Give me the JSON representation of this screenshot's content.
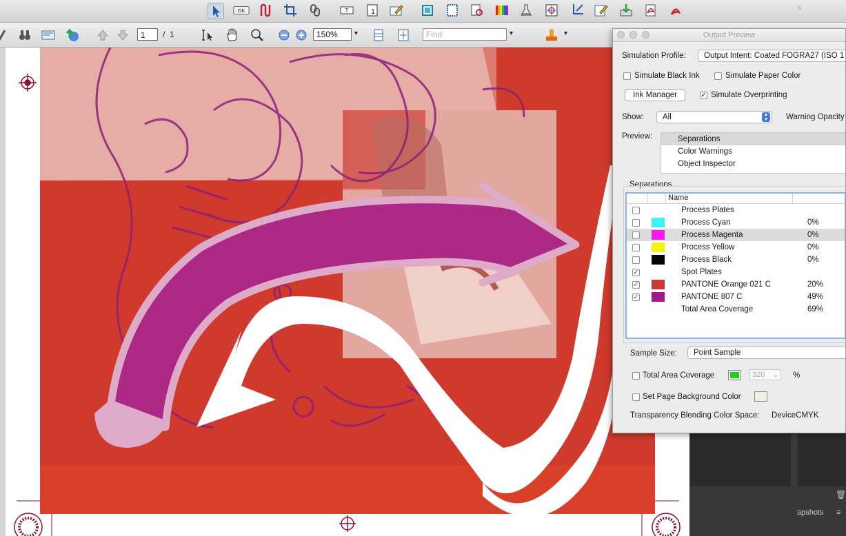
{
  "toolbar_nav": {
    "page_current": "1",
    "page_separator": "/",
    "page_total": "1",
    "zoom": "150%",
    "find_placeholder": "Find"
  },
  "toolbar_icons": [
    "select-arrow-icon",
    "ok-button-icon",
    "path-tool-icon",
    "crop-icon",
    "link-icon",
    "text-field-icon",
    "page-number-icon",
    "edit-icon",
    "trim-box-icon",
    "page-box-icon",
    "preflight-icon",
    "color-bars-icon",
    "flask-icon",
    "registration-target-icon",
    "object-crop-icon",
    "pencil-icon",
    "export-icon",
    "pdf-icon",
    "acrobat-icon"
  ],
  "output_preview": {
    "title": "Output Preview",
    "simulation_profile_label": "Simulation Profile:",
    "simulation_profile_value": "Output Intent: Coated FOGRA27 (ISO 1",
    "simulate_black_ink": "Simulate Black Ink",
    "simulate_black_ink_checked": false,
    "simulate_paper_color": "Simulate Paper Color",
    "simulate_paper_color_checked": false,
    "ink_manager": "Ink Manager",
    "simulate_overprinting": "Simulate Overprinting",
    "simulate_overprinting_checked": true,
    "show_label": "Show:",
    "show_value": "All",
    "warning_opacity": "Warning Opacity",
    "preview_label": "Preview:",
    "preview_options": [
      "Separations",
      "Color Warnings",
      "Object Inspector"
    ],
    "preview_selected": "Separations",
    "separations_group": "Separations",
    "separations_header_name": "Name",
    "separations": [
      {
        "name": "Process Plates",
        "pct": "",
        "color": "",
        "checked": false,
        "highlight": false
      },
      {
        "name": "Process Cyan",
        "pct": "0%",
        "color": "#3ef3f7",
        "checked": false,
        "highlight": false
      },
      {
        "name": "Process Magenta",
        "pct": "0%",
        "color": "#f21cee",
        "checked": false,
        "highlight": true
      },
      {
        "name": "Process Yellow",
        "pct": "0%",
        "color": "#f7f212",
        "checked": false,
        "highlight": false
      },
      {
        "name": "Process Black",
        "pct": "0%",
        "color": "#050505",
        "checked": false,
        "highlight": false
      },
      {
        "name": "Spot Plates",
        "pct": "",
        "color": "",
        "checked": true,
        "highlight": false
      },
      {
        "name": "PANTONE Orange 021 C",
        "pct": "20%",
        "color": "#c93a30",
        "checked": true,
        "highlight": false
      },
      {
        "name": "PANTONE 807 C",
        "pct": "49%",
        "color": "#a1198a",
        "checked": true,
        "highlight": false
      },
      {
        "name": "Total Area Coverage",
        "pct": "69%",
        "color": "",
        "checked": null,
        "highlight": false
      }
    ],
    "sample_size_label": "Sample Size:",
    "sample_size_value": "Point Sample",
    "total_area_coverage": "Total Area Coverage",
    "total_area_coverage_checked": false,
    "coverage_limit": "320",
    "percent_sign": "%",
    "coverage_color": "#22cc22",
    "set_page_background": "Set Page Background Color",
    "set_page_background_checked": false,
    "page_background_color": "#f1f1dc",
    "transparency_label": "Transparency Blending Color Space:",
    "transparency_value": "DeviceCMYK"
  },
  "right_panel": {
    "snapshots": "apshots",
    "top_letter": "s"
  },
  "colors": {
    "art_red": "#cf3a2c",
    "art_magenta": "#ac2885",
    "registration_mark": "#8a1232"
  }
}
